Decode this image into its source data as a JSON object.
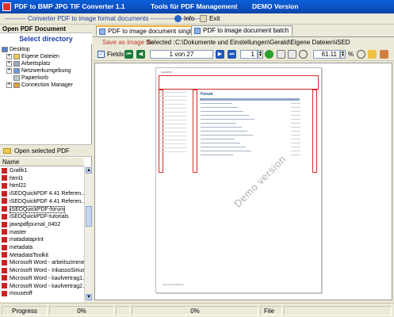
{
  "window": {
    "title_app": "PDF to BMP JPG TIF Converter 1.1",
    "title_tools": "Tools für PDF Management",
    "title_version": "DEMO Version"
  },
  "subbar": {
    "description": "---------- Converter PDF to image format documents -------------------------",
    "info_label": "Info",
    "exit_label": "Exit"
  },
  "left_panel": {
    "header": "Open PDF Document",
    "select_directory": "Select directory",
    "tree": [
      {
        "label": "Desktop",
        "expander": ""
      },
      {
        "label": "Eigene Dateien",
        "expander": "+"
      },
      {
        "label": "Arbeitsplatz",
        "expander": "+"
      },
      {
        "label": "Netzwerkumgebung",
        "expander": "+"
      },
      {
        "label": "Papierkorb",
        "expander": ""
      },
      {
        "label": "Connection Manager",
        "expander": "+"
      }
    ],
    "open_selected_pdf": "Open selected PDF",
    "list_header": "Name",
    "files": [
      "Grafik1",
      "html1",
      "html22",
      "iSEDQuickPDF 4.41 Referen...",
      "iSEDQuickPDF 4.41 Referen...",
      "iSEDQuickPDF-forum",
      "iSEDQuickPDF-tutorials",
      "jawspdfjournal_0402",
      "master",
      "matadataprint",
      "metadata",
      "MetadataToolkit",
      "Microsoft Word - arbeitszimmer",
      "Microsoft Word - InkassoSirius",
      "Microsoft Word - kaufvertrag1...",
      "Microsoft Word - kaufvertrag2...",
      "mouseoff"
    ],
    "selected_index": 5
  },
  "tabs": [
    {
      "label": "PDF to image document single",
      "active": true
    },
    {
      "label": "PDF to image document batch",
      "active": false
    }
  ],
  "save_row": {
    "save_label": "Save as image file",
    "selected_label": "Selected :",
    "selected_path": "C:\\Dokumente und Einstellungen\\Gerald\\Eigene Dateien\\iSED"
  },
  "toolbar": {
    "fields_label": "Fields",
    "fields_checked": true,
    "page_display": "1 von 27",
    "page_input": "1",
    "zoom_value": "61.11",
    "zoom_unit": "%"
  },
  "document": {
    "page_header": "QuickPDF",
    "forum_title": "Forum",
    "watermark": "Demo version",
    "footer_url": "http://www.quickpdf.com",
    "post_count": 14
  },
  "statusbar": {
    "progress_label": "Progress",
    "progress1": "0%",
    "progress2": "0%",
    "file_label": "File"
  },
  "colors": {
    "titlebar": "#0d4fbf",
    "accent_blue": "#1b3da8",
    "save_red": "#c0392b",
    "field_box_red": "#d42a2a"
  }
}
